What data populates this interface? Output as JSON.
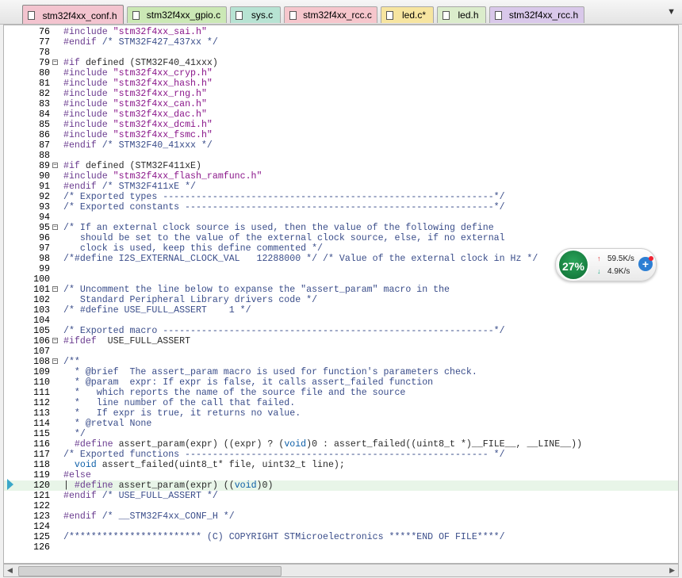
{
  "tabs": [
    {
      "label": "stm32f4xx_conf.h",
      "color": "#f3c4cf",
      "active": true
    },
    {
      "label": "stm32f4xx_gpio.c",
      "color": "#cbe8b5",
      "active": false
    },
    {
      "label": "sys.c",
      "color": "#b7e3d3",
      "active": false
    },
    {
      "label": "stm32f4xx_rcc.c",
      "color": "#f6c6cc",
      "active": false
    },
    {
      "label": "led.c*",
      "color": "#f7e5a0",
      "active": false
    },
    {
      "label": "led.h",
      "color": "#dbeccb",
      "active": false
    },
    {
      "label": "stm32f4xx_rcc.h",
      "color": "#d9c8ea",
      "active": false
    }
  ],
  "dropdown_icon": "chevron-down-icon",
  "lines": [
    {
      "n": "76",
      "segs": [
        [
          "pre",
          "#include "
        ],
        [
          "str",
          "\"stm32f4xx_sai.h\""
        ]
      ]
    },
    {
      "n": "77",
      "segs": [
        [
          "pre",
          "#endif "
        ],
        [
          "comment",
          "/* STM32F427_437xx */"
        ]
      ]
    },
    {
      "n": "78",
      "segs": []
    },
    {
      "n": "79",
      "fold": true,
      "segs": [
        [
          "pre",
          "#if "
        ],
        [
          "macro",
          "defined (STM32F40_41xxx)"
        ]
      ]
    },
    {
      "n": "80",
      "segs": [
        [
          "pre",
          "#include "
        ],
        [
          "str",
          "\"stm32f4xx_cryp.h\""
        ]
      ]
    },
    {
      "n": "81",
      "segs": [
        [
          "pre",
          "#include "
        ],
        [
          "str",
          "\"stm32f4xx_hash.h\""
        ]
      ]
    },
    {
      "n": "82",
      "segs": [
        [
          "pre",
          "#include "
        ],
        [
          "str",
          "\"stm32f4xx_rng.h\""
        ]
      ]
    },
    {
      "n": "83",
      "segs": [
        [
          "pre",
          "#include "
        ],
        [
          "str",
          "\"stm32f4xx_can.h\""
        ]
      ]
    },
    {
      "n": "84",
      "segs": [
        [
          "pre",
          "#include "
        ],
        [
          "str",
          "\"stm32f4xx_dac.h\""
        ]
      ]
    },
    {
      "n": "85",
      "segs": [
        [
          "pre",
          "#include "
        ],
        [
          "str",
          "\"stm32f4xx_dcmi.h\""
        ]
      ]
    },
    {
      "n": "86",
      "segs": [
        [
          "pre",
          "#include "
        ],
        [
          "str",
          "\"stm32f4xx_fsmc.h\""
        ]
      ]
    },
    {
      "n": "87",
      "segs": [
        [
          "pre",
          "#endif "
        ],
        [
          "comment",
          "/* STM32F40_41xxx */"
        ]
      ]
    },
    {
      "n": "88",
      "segs": []
    },
    {
      "n": "89",
      "fold": true,
      "segs": [
        [
          "pre",
          "#if "
        ],
        [
          "macro",
          "defined (STM32F411xE)"
        ]
      ]
    },
    {
      "n": "90",
      "segs": [
        [
          "pre",
          "#include "
        ],
        [
          "str",
          "\"stm32f4xx_flash_ramfunc.h\""
        ]
      ]
    },
    {
      "n": "91",
      "segs": [
        [
          "pre",
          "#endif "
        ],
        [
          "comment",
          "/* STM32F411xE */"
        ]
      ]
    },
    {
      "n": "92",
      "segs": [
        [
          "comment",
          "/* Exported types ------------------------------------------------------------*/"
        ]
      ]
    },
    {
      "n": "93",
      "segs": [
        [
          "comment",
          "/* Exported constants --------------------------------------------------------*/"
        ]
      ]
    },
    {
      "n": "94",
      "segs": []
    },
    {
      "n": "95",
      "fold": true,
      "segs": [
        [
          "comment",
          "/* If an external clock source is used, then the value of the following define"
        ]
      ]
    },
    {
      "n": "96",
      "segs": [
        [
          "comment",
          "   should be set to the value of the external clock source, else, if no external"
        ]
      ]
    },
    {
      "n": "97",
      "segs": [
        [
          "comment",
          "   clock is used, keep this define commented */"
        ]
      ]
    },
    {
      "n": "98",
      "segs": [
        [
          "comment",
          "/*#define I2S_EXTERNAL_CLOCK_VAL   12288000 */ /* Value of the external clock in Hz */"
        ]
      ]
    },
    {
      "n": "99",
      "segs": []
    },
    {
      "n": "100",
      "segs": []
    },
    {
      "n": "101",
      "fold": true,
      "segs": [
        [
          "comment",
          "/* Uncomment the line below to expanse the \"assert_param\" macro in the"
        ]
      ]
    },
    {
      "n": "102",
      "segs": [
        [
          "comment",
          "   Standard Peripheral Library drivers code */"
        ]
      ]
    },
    {
      "n": "103",
      "segs": [
        [
          "comment",
          "/* #define USE_FULL_ASSERT    1 */"
        ]
      ]
    },
    {
      "n": "104",
      "segs": []
    },
    {
      "n": "105",
      "segs": [
        [
          "comment",
          "/* Exported macro ------------------------------------------------------------*/"
        ]
      ]
    },
    {
      "n": "106",
      "fold": true,
      "segs": [
        [
          "pre",
          "#ifdef  "
        ],
        [
          "macro",
          "USE_FULL_ASSERT"
        ]
      ]
    },
    {
      "n": "107",
      "segs": []
    },
    {
      "n": "108",
      "fold": true,
      "segs": [
        [
          "comment",
          "/**"
        ]
      ]
    },
    {
      "n": "109",
      "segs": [
        [
          "comment",
          "  * @brief  The assert_param macro is used for function's parameters check."
        ]
      ]
    },
    {
      "n": "110",
      "segs": [
        [
          "comment",
          "  * @param  expr: If expr is false, it calls assert_failed function"
        ]
      ]
    },
    {
      "n": "111",
      "segs": [
        [
          "comment",
          "  *   which reports the name of the source file and the source"
        ]
      ]
    },
    {
      "n": "112",
      "segs": [
        [
          "comment",
          "  *   line number of the call that failed."
        ]
      ]
    },
    {
      "n": "113",
      "segs": [
        [
          "comment",
          "  *   If expr is true, it returns no value."
        ]
      ]
    },
    {
      "n": "114",
      "segs": [
        [
          "comment",
          "  * @retval None"
        ]
      ]
    },
    {
      "n": "115",
      "segs": [
        [
          "comment",
          "  */"
        ]
      ]
    },
    {
      "n": "116",
      "segs": [
        [
          "pre",
          "  #define "
        ],
        [
          "macro",
          "assert_param(expr) ((expr) ? ("
        ],
        [
          "kw",
          "void"
        ],
        [
          "macro",
          ")0 : assert_failed((uint8_t *)__FILE__, __LINE__))"
        ]
      ]
    },
    {
      "n": "117",
      "segs": [
        [
          "comment",
          "/* Exported functions ------------------------------------------------------- */"
        ]
      ]
    },
    {
      "n": "118",
      "segs": [
        [
          "kw",
          "  void "
        ],
        [
          "macro",
          "assert_failed(uint8_t* file, uint32_t line);"
        ]
      ]
    },
    {
      "n": "119",
      "segs": [
        [
          "pre",
          "#else"
        ]
      ]
    },
    {
      "n": "120",
      "current": true,
      "segs": [
        [
          "macro",
          "| "
        ],
        [
          "pre",
          "#define "
        ],
        [
          "macro",
          "assert_param(expr) (("
        ],
        [
          "kw",
          "void"
        ],
        [
          "macro",
          ")0)"
        ]
      ]
    },
    {
      "n": "121",
      "segs": [
        [
          "pre",
          "#endif "
        ],
        [
          "comment",
          "/* USE_FULL_ASSERT */"
        ]
      ]
    },
    {
      "n": "122",
      "segs": []
    },
    {
      "n": "123",
      "segs": [
        [
          "pre",
          "#endif "
        ],
        [
          "comment",
          "/* __STM32F4xx_CONF_H */"
        ]
      ]
    },
    {
      "n": "124",
      "segs": []
    },
    {
      "n": "125",
      "segs": [
        [
          "comment",
          "/************************ (C) COPYRIGHT STMicroelectronics *****END OF FILE****/"
        ]
      ]
    },
    {
      "n": "126",
      "segs": []
    }
  ],
  "net_widget": {
    "cpu_percent": "27%",
    "upload": "59.5K/s",
    "download": "4.9K/s",
    "up_icon": "arrow-up-icon",
    "down_icon": "arrow-down-icon",
    "add_icon": "plus-icon"
  }
}
